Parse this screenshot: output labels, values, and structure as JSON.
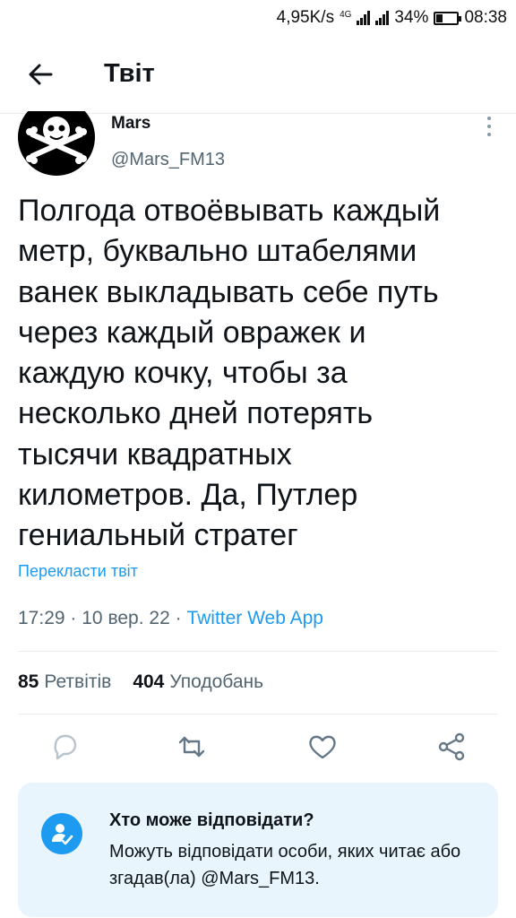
{
  "status_bar": {
    "net_speed": "4,95K/s",
    "net_tag": "4G",
    "battery": "34%",
    "battery_level": 0.34,
    "time": "08:38"
  },
  "header": {
    "title": "Твіт",
    "back_icon": "arrow-left-icon"
  },
  "tweet": {
    "author_name": "Mars",
    "author_handle": "@Mars_FM13",
    "avatar_icon": "skull-crossbones-icon",
    "text": "Полгода отвоёвывать каждый\nметр, буквально штабелями\nванек выкладывать себе путь\nчерез каждый овражек и\nкаждую кочку, чтобы за\nнесколько дней потерять\nтысячи квадратных\nкилометров. Да, Путлер\nгениальный стратег",
    "translate_label": "Перекласти твіт",
    "time": "17:29",
    "date": "10 вер. 22",
    "separator": "·",
    "source": "Twitter Web App"
  },
  "stats": {
    "retweets_count": "85",
    "retweets_label": "Ретвітів",
    "likes_count": "404",
    "likes_label": "Уподобань"
  },
  "actions": {
    "icons": [
      "reply-icon",
      "retweet-icon",
      "like-icon",
      "share-icon"
    ],
    "accent": "#657786"
  },
  "reply_info": {
    "title": "Хто може відповідати?",
    "description": "Можуть відповідати особи, яких читає або згадав(ла) @Mars_FM13.",
    "accent": "#1d9bf0",
    "background": "#e8f5fd"
  }
}
